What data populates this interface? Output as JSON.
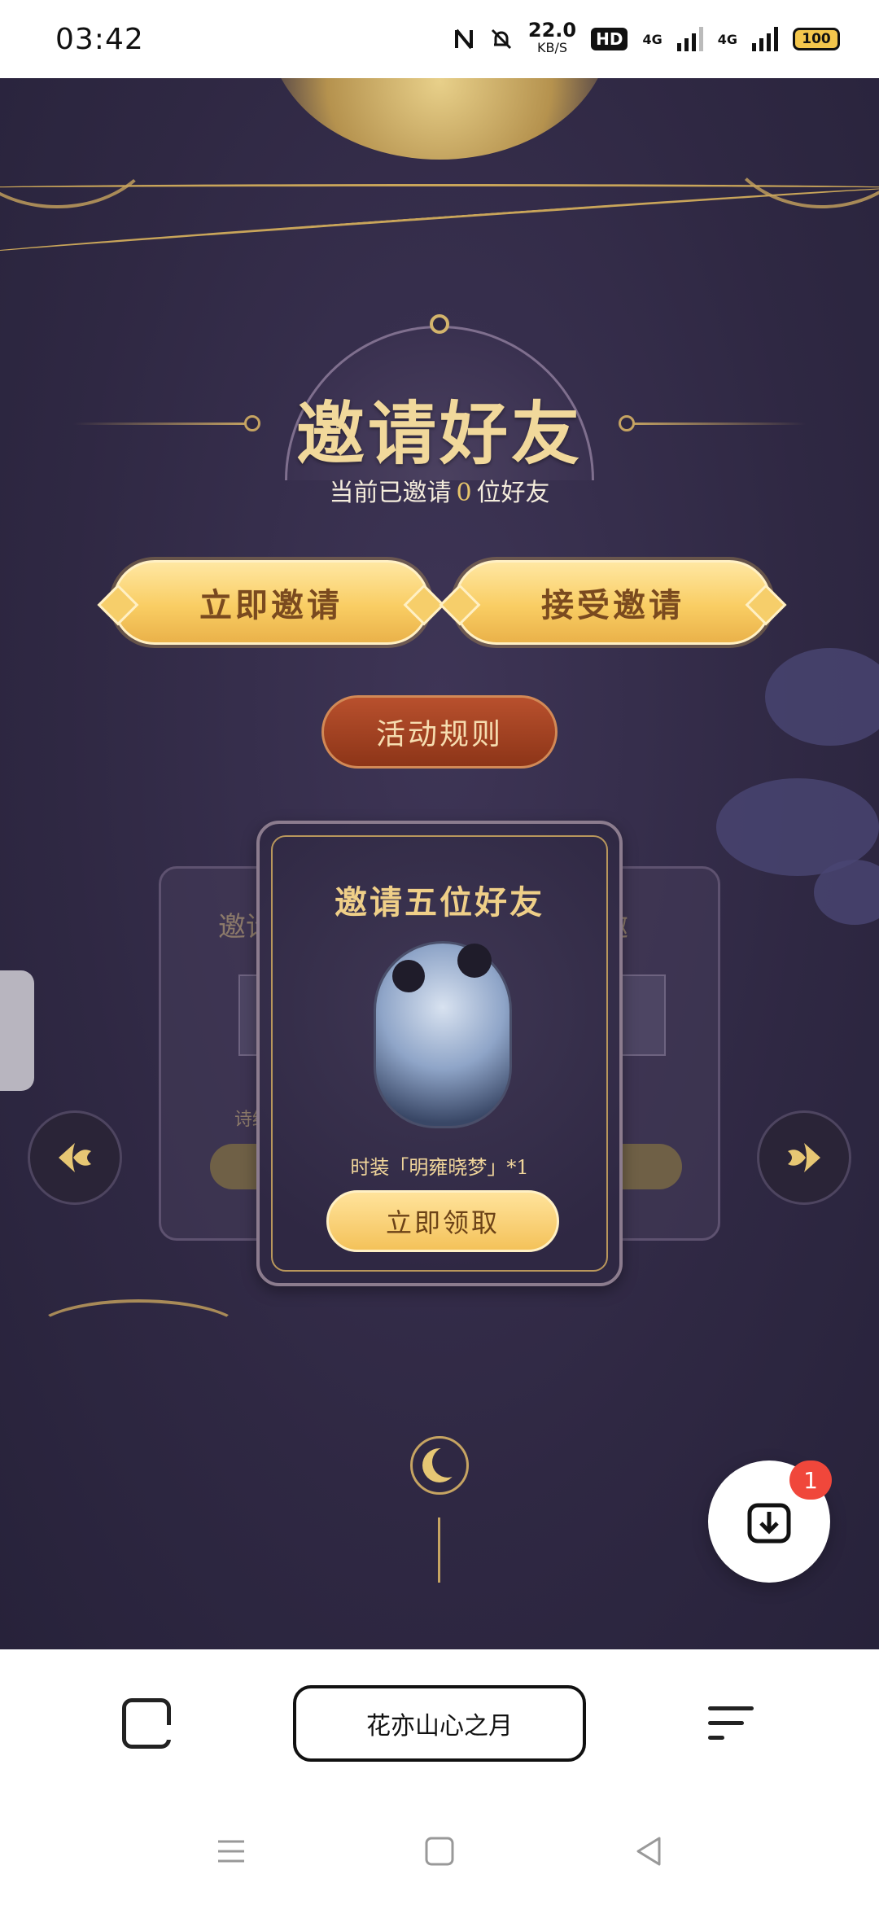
{
  "status_bar": {
    "time": "03:42",
    "net_speed_value": "22.0",
    "net_speed_unit": "KB/S",
    "hd_label": "HD",
    "signal_label_1": "4G",
    "signal_label_2": "4G",
    "battery": "100",
    "icons": [
      "nfc-icon",
      "bell-muted-icon",
      "hd-icon",
      "signal-icon",
      "signal-icon",
      "battery-icon"
    ]
  },
  "page": {
    "title": "邀请好友",
    "invited_prefix": "当前已邀请",
    "invited_count": "0",
    "invited_suffix": "位好友"
  },
  "buttons": {
    "invite_now": "立即邀请",
    "accept_invite": "接受邀请",
    "rules": "活动规则"
  },
  "cards": {
    "active": {
      "title": "邀请五位好友",
      "reward": "时装「明雍晓梦」*1",
      "claim_button": "立即领取"
    },
    "left_partial_title": "邀请",
    "left_partial_text": "诗结",
    "right_partial_title": "邀"
  },
  "floating": {
    "badge_count": "1"
  },
  "browser": {
    "address": "花亦山心之月"
  },
  "colors": {
    "background": "#2f2843",
    "gold": "#f1d89b",
    "button_gold": "#f9cd63",
    "rules_red": "#a4431f",
    "badge": "#f0473b"
  }
}
